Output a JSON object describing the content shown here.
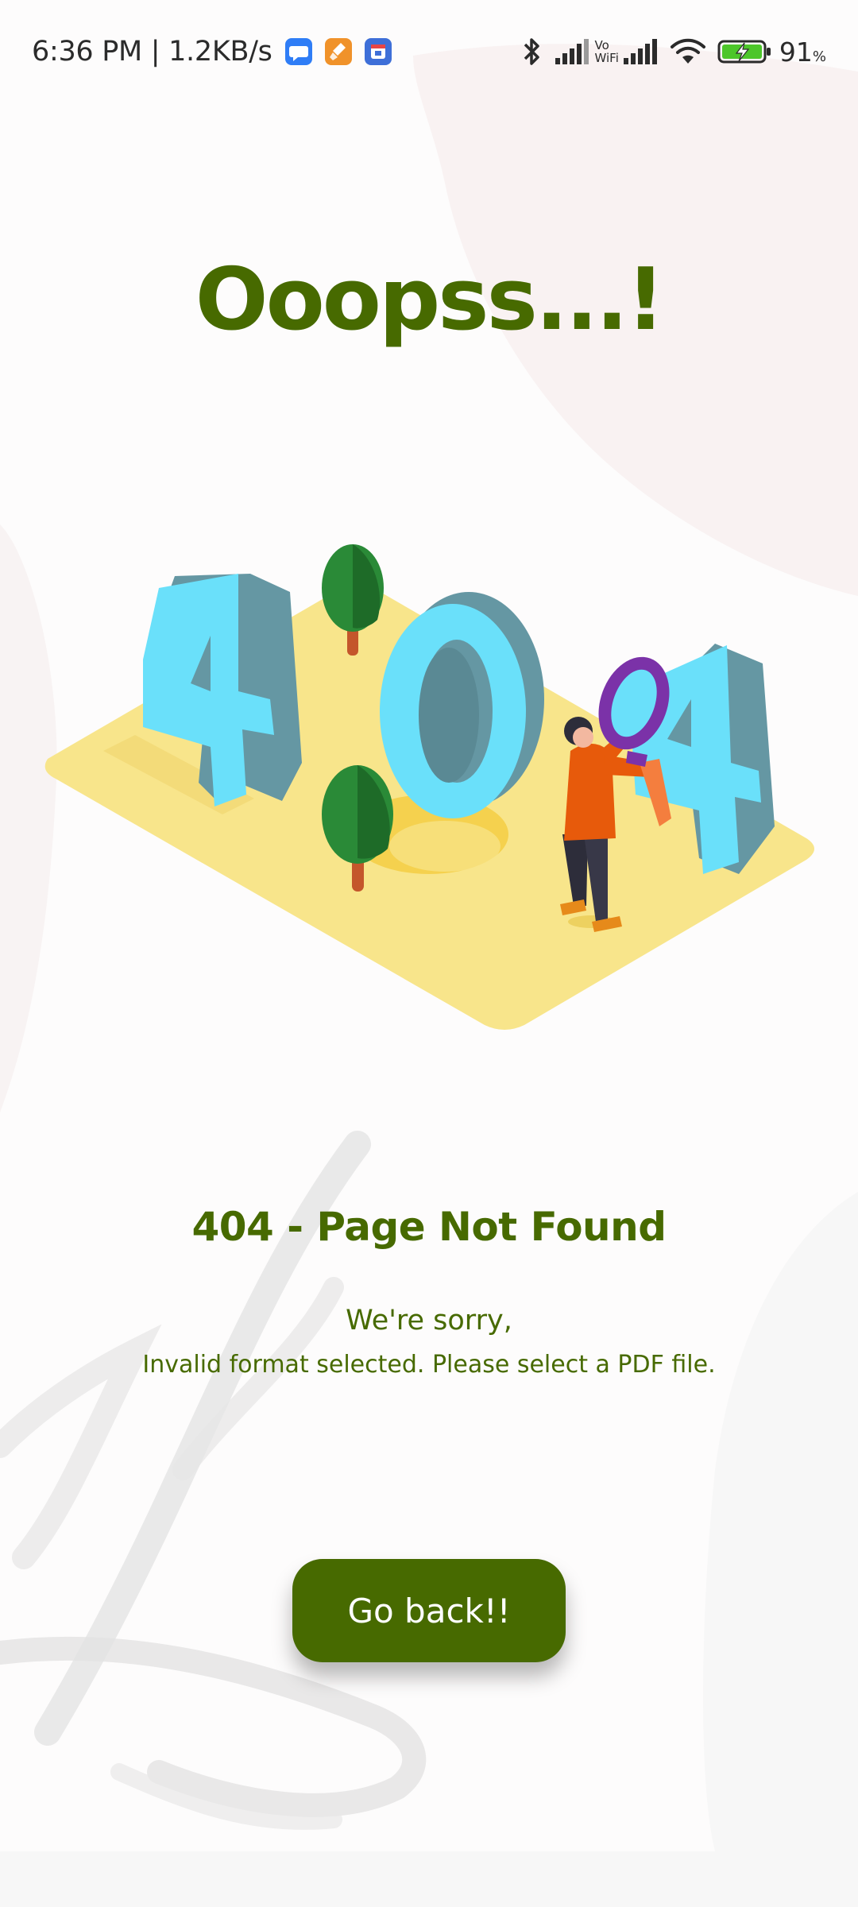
{
  "status_bar": {
    "time_speed": "6:36 PM | 1.2KB/s",
    "vowifi_top": "Vo",
    "vowifi_bottom": "WiFi",
    "battery_percent": "91",
    "battery_unit": "%",
    "icons": [
      "messages-icon",
      "cleaner-icon",
      "calendar-icon",
      "bluetooth-icon",
      "signal-icon",
      "vowifi-icon",
      "signal-icon",
      "wifi-icon",
      "battery-charging-icon"
    ]
  },
  "page": {
    "title": "Ooopss...!",
    "heading": "404 - Page Not Found",
    "sorry": "We're sorry,",
    "message": "Invalid format selected. Please select a PDF file.",
    "button_label": "Go back!!"
  },
  "colors": {
    "brand_green": "#476a00",
    "digit_face": "#6ae0fa",
    "digit_side": "#6597a3",
    "platform": "#f8e58b",
    "person_shirt": "#e75a0b",
    "magnifier": "#7b32a8"
  },
  "illustration": {
    "digits": [
      "4",
      "0",
      "4"
    ]
  }
}
